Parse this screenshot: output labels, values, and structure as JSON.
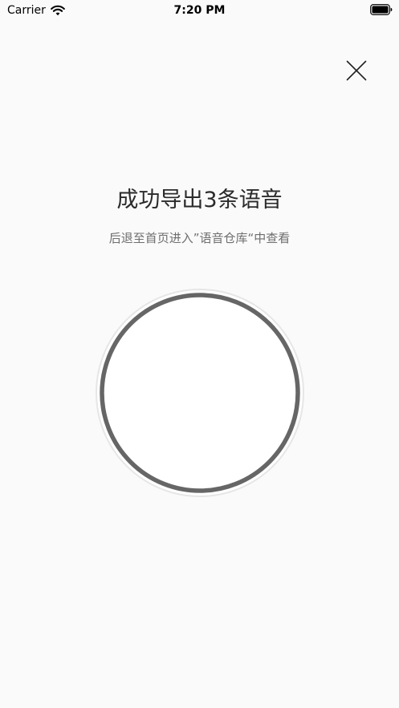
{
  "status_bar": {
    "carrier": "Carrier",
    "time": "7:20 PM",
    "wifi_icon": "wifi-icon",
    "battery_icon": "battery-icon"
  },
  "header": {
    "close_icon": "close-icon"
  },
  "main": {
    "title": "成功导出3条语音",
    "subtitle": "后退至首页进入”语音仓库“中查看"
  },
  "colors": {
    "background": "#fafafa",
    "title_text": "#2a2a2a",
    "subtitle_text": "#6e6e6e",
    "ring": "#666666",
    "ring_outer": "#e6e6e6"
  }
}
